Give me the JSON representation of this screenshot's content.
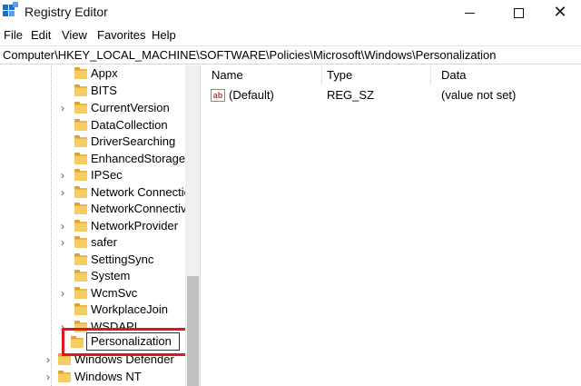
{
  "window": {
    "title": "Registry Editor"
  },
  "menu": [
    "File",
    "Edit",
    "View",
    "Favorites",
    "Help"
  ],
  "address": "Computer\\HKEY_LOCAL_MACHINE\\SOFTWARE\\Policies\\Microsoft\\Windows\\Personalization",
  "tree": {
    "children": [
      {
        "label": "Appx",
        "expandable": false
      },
      {
        "label": "BITS",
        "expandable": false
      },
      {
        "label": "CurrentVersion",
        "expandable": true
      },
      {
        "label": "DataCollection",
        "expandable": false
      },
      {
        "label": "DriverSearching",
        "expandable": false
      },
      {
        "label": "EnhancedStorageD",
        "expandable": false
      },
      {
        "label": "IPSec",
        "expandable": true
      },
      {
        "label": "Network Connectic",
        "expandable": true
      },
      {
        "label": "NetworkConnectivi",
        "expandable": false
      },
      {
        "label": "NetworkProvider",
        "expandable": true
      },
      {
        "label": "safer",
        "expandable": true
      },
      {
        "label": "SettingSync",
        "expandable": false
      },
      {
        "label": "System",
        "expandable": false
      },
      {
        "label": "WcmSvc",
        "expandable": true
      },
      {
        "label": "WorkplaceJoin",
        "expandable": false
      },
      {
        "label": "WSDAPI",
        "expandable": false
      }
    ],
    "rename_value": "Personalization",
    "siblings": [
      {
        "label": "Windows Defender",
        "expandable": true
      },
      {
        "label": "Windows NT",
        "expandable": true
      }
    ]
  },
  "list": {
    "columns": [
      "Name",
      "Type",
      "Data"
    ],
    "rows": [
      {
        "name": "(Default)",
        "type": "REG_SZ",
        "data": "(value not set)"
      }
    ]
  },
  "colors": {
    "highlight": "#e0161d",
    "folder": "#f5cd62"
  }
}
